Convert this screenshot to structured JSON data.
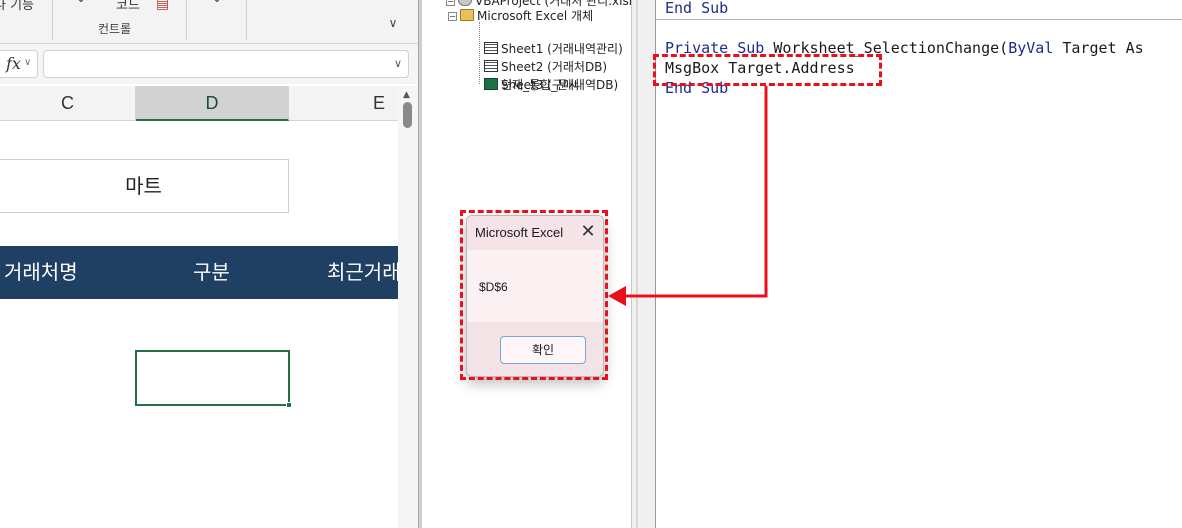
{
  "ribbon": {
    "left_fragment": "나 기능",
    "group_fragment": "코드",
    "group_label": "컨트롤",
    "collapse_icon": "chevron-down-icon"
  },
  "formula_bar": {
    "fx_label": "fx",
    "value": ""
  },
  "columns": [
    "C",
    "D",
    "E"
  ],
  "sheet": {
    "title_cell": "마트",
    "header_row": [
      "거래처명",
      "구분",
      "최근거래"
    ]
  },
  "project_tree": {
    "root_fragment": "VBAProject (거래처 관리.xlsm)",
    "folder": "Microsoft Excel 개체",
    "items": [
      "Sheet1 (거래내역관리)",
      "Sheet2 (거래처DB)",
      "Sheet3 (구매내역DB)",
      "현재_통합_문서"
    ]
  },
  "code": {
    "line1": "End Sub",
    "line2_kw1": "Private Sub ",
    "line2_name": "Worksheet_SelectionChange(",
    "line2_kw2": "ByVal",
    "line2_rest": " Target As",
    "line3": "MsgBox Target.Address",
    "line4": "End Sub"
  },
  "dialog": {
    "title": "Microsoft Excel",
    "message": "$D$6",
    "ok_label": "확인",
    "close_icon": "close-icon"
  },
  "colors": {
    "annotation_red": "#e8101a",
    "header_band": "#1f3f63",
    "excel_green": "#217346",
    "vba_keyword": "#1d2b8f"
  }
}
